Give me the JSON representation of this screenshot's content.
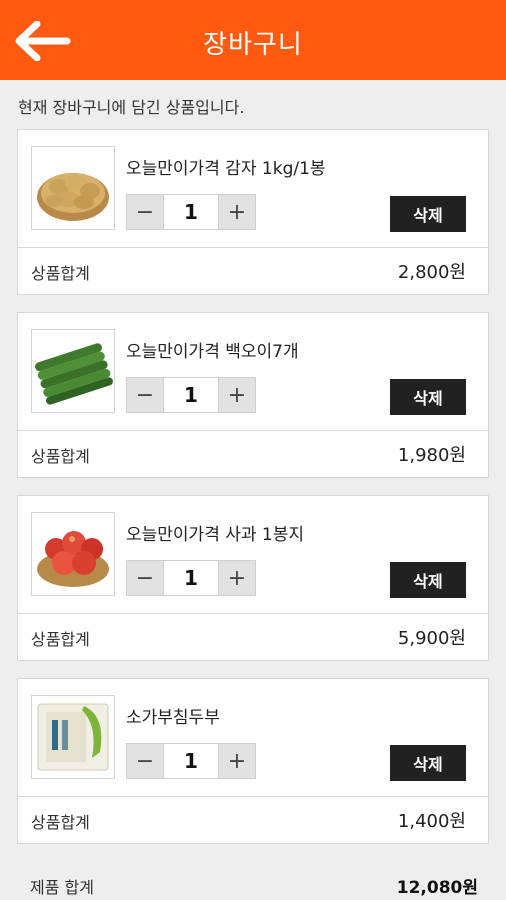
{
  "header": {
    "title": "장바구니",
    "back_icon": "arrow-left-icon",
    "bg_color": "#ff5a0f"
  },
  "intro_text": "현재 장바구니에 담긴 상품입니다.",
  "items": [
    {
      "name": "오늘만이가격 감자 1kg/1봉",
      "qty": "1",
      "minus": "−",
      "plus": "+",
      "delete_label": "삭제",
      "sum_label": "상품합계",
      "sum_value": "2,800원",
      "image": "potato-image"
    },
    {
      "name": "오늘만이가격 백오이7개",
      "qty": "1",
      "minus": "−",
      "plus": "+",
      "delete_label": "삭제",
      "sum_label": "상품합계",
      "sum_value": "1,980원",
      "image": "cucumber-image"
    },
    {
      "name": "오늘만이가격 사과 1봉지",
      "qty": "1",
      "minus": "−",
      "plus": "+",
      "delete_label": "삭제",
      "sum_label": "상품합계",
      "sum_value": "5,900원",
      "image": "apple-image"
    },
    {
      "name": "소가부침두부",
      "qty": "1",
      "minus": "−",
      "plus": "+",
      "delete_label": "삭제",
      "sum_label": "상품합계",
      "sum_value": "1,400원",
      "image": "tofu-image"
    }
  ],
  "total": {
    "label": "제품 합계",
    "value": "12,080원"
  }
}
